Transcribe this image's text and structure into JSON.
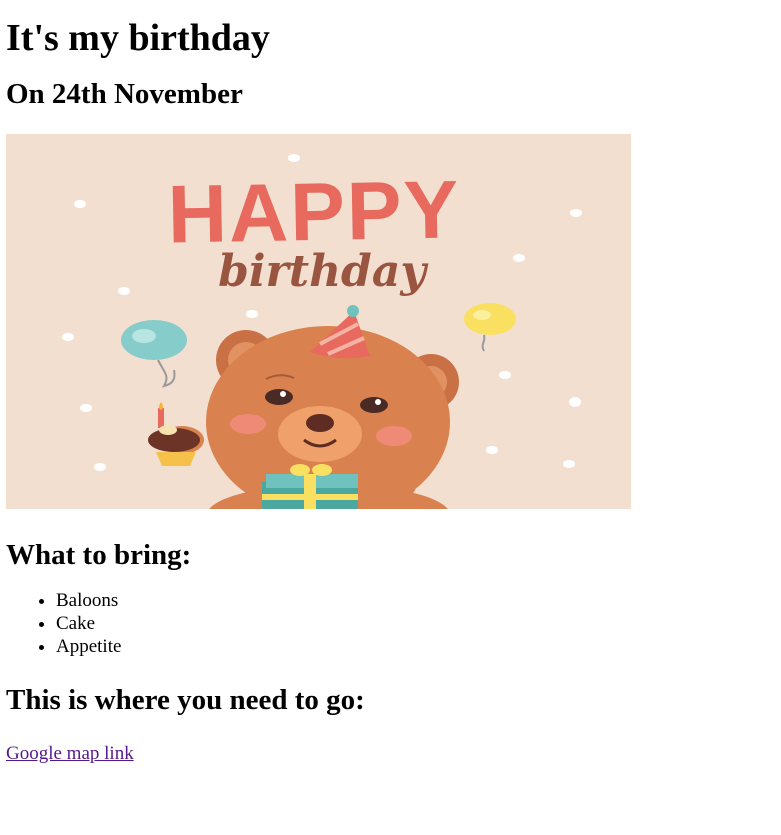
{
  "page": {
    "title": "It's my birthday",
    "subtitle": "On 24th November"
  },
  "banner": {
    "headline": "HAPPY",
    "script_text": "birthday",
    "icon": "teddy-bear-birthday-illustration",
    "colors": {
      "background": "#f2dfd0",
      "headline": "#e8695e",
      "script": "#9a5540",
      "bear": "#d9824f",
      "bear_face": "#f0a06a",
      "balloon_blue": "#86cccb",
      "balloon_yellow": "#f9e061",
      "gift": "#4aa8a0"
    }
  },
  "bring": {
    "heading": "What to bring:",
    "items": [
      "Baloons",
      "Cake",
      "Appetite"
    ]
  },
  "location": {
    "heading": "This is where you need to go:",
    "link_text": "Google map link"
  }
}
